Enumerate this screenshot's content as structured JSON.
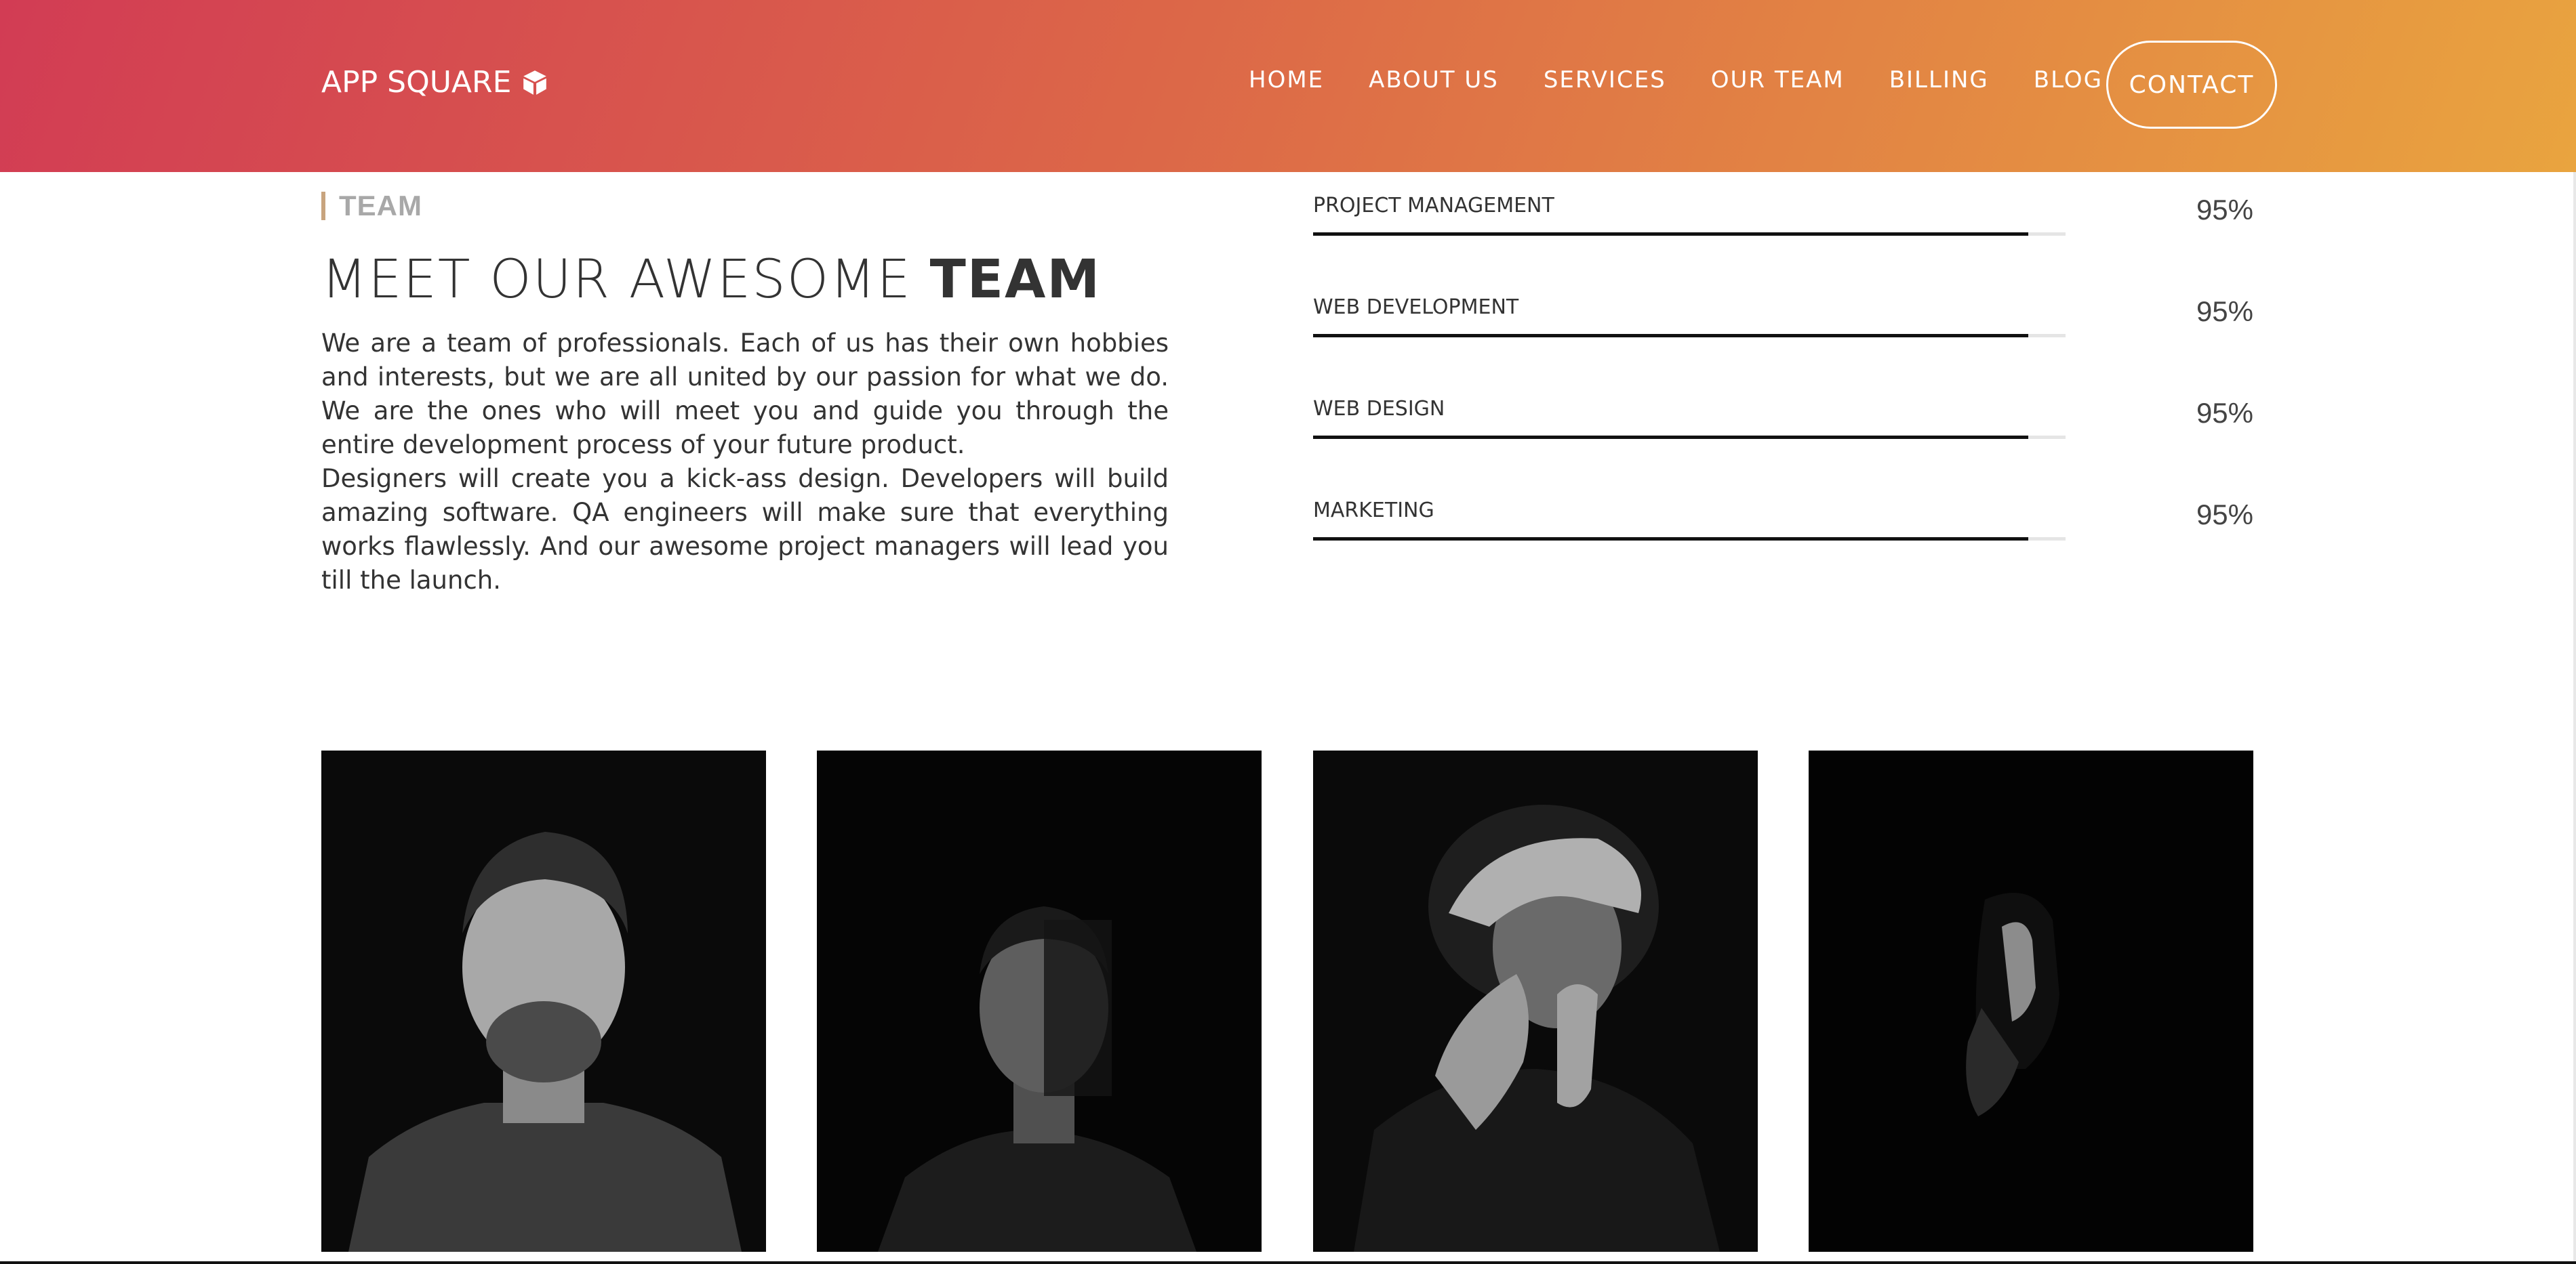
{
  "header": {
    "logo_text": "APP SQUARE",
    "logo_icon": "cube-icon",
    "nav": [
      "HOME",
      "ABOUT US",
      "SERVICES",
      "OUR TEAM",
      "BILLING",
      "BLOG"
    ],
    "contact_label": "CONTACT",
    "gradient_colors": [
      "#d23c54",
      "#e9a43f"
    ]
  },
  "section": {
    "tag": "TEAM",
    "title_light": "MEET OUR AWESOME ",
    "title_bold": "TEAM",
    "paragraph_1": "We are a team of professionals. Each of us has their own hobbies and interests, but we are all united by our passion for what we do. We are the ones who will meet you and guide you through the entire development process of your future product.",
    "paragraph_2": "Designers will create you a kick-ass design. Developers will build amazing software. QA engineers will make sure that everything works flawlessly. And our awesome project managers will lead you till the launch."
  },
  "skills": [
    {
      "label": "PROJECT MANAGEMENT",
      "value": 95,
      "display": "95%"
    },
    {
      "label": "WEB DEVELOPMENT",
      "value": 95,
      "display": "95%"
    },
    {
      "label": "WEB DESIGN",
      "value": 95,
      "display": "95%"
    },
    {
      "label": "MARKETING",
      "value": 95,
      "display": "95%"
    }
  ],
  "team_photos": [
    "team-member-photo-1",
    "team-member-photo-2",
    "team-member-photo-3",
    "team-member-photo-4"
  ]
}
